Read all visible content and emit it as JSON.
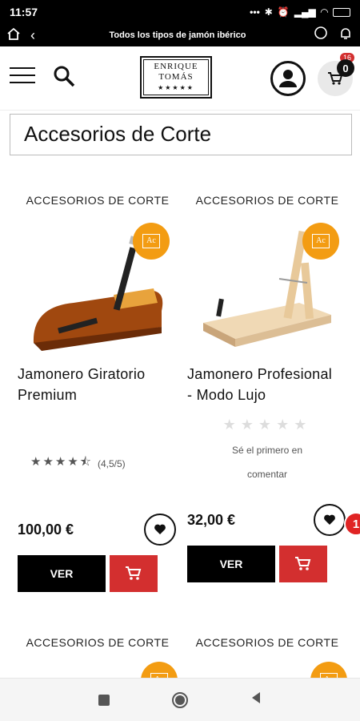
{
  "status": {
    "time": "11:57",
    "icons": [
      "notification-dots-icon",
      "bluetooth-icon",
      "alarm-icon",
      "signal-icon",
      "wifi-icon",
      "battery-icon"
    ]
  },
  "browser": {
    "title": "Todos los tipos de jamón ibérico"
  },
  "header": {
    "logo_line1": "ENRIQUE",
    "logo_line2": "TOMÁS",
    "logo_stars": "★★★★★",
    "cart_count": "0",
    "cart_badge": "16"
  },
  "category": {
    "title": "Accesorios de Corte"
  },
  "products": [
    {
      "category": "ACCESORIOS DE CORTE",
      "name": "Jamonero Giratorio Premium",
      "rating": "★★★★⯪",
      "rating_text": "(4,5/5)",
      "price": "100,00 €",
      "button": "VER"
    },
    {
      "category": "ACCESORIOS DE CORTE",
      "name": "Jamonero Profesional - Modo Lujo",
      "empty_stars": "★★★★★",
      "rating_text_1": "Sé el primero en",
      "rating_text_2": "comentar",
      "price": "32,00 €",
      "button": "VER",
      "notif_count": "1"
    }
  ],
  "next_row": [
    {
      "category": "ACCESORIOS DE CORTE"
    },
    {
      "category": "ACCESORIOS DE CORTE"
    }
  ],
  "colors": {
    "accent_red": "#d32f2f",
    "badge_orange": "#f39c12",
    "black": "#000000"
  }
}
